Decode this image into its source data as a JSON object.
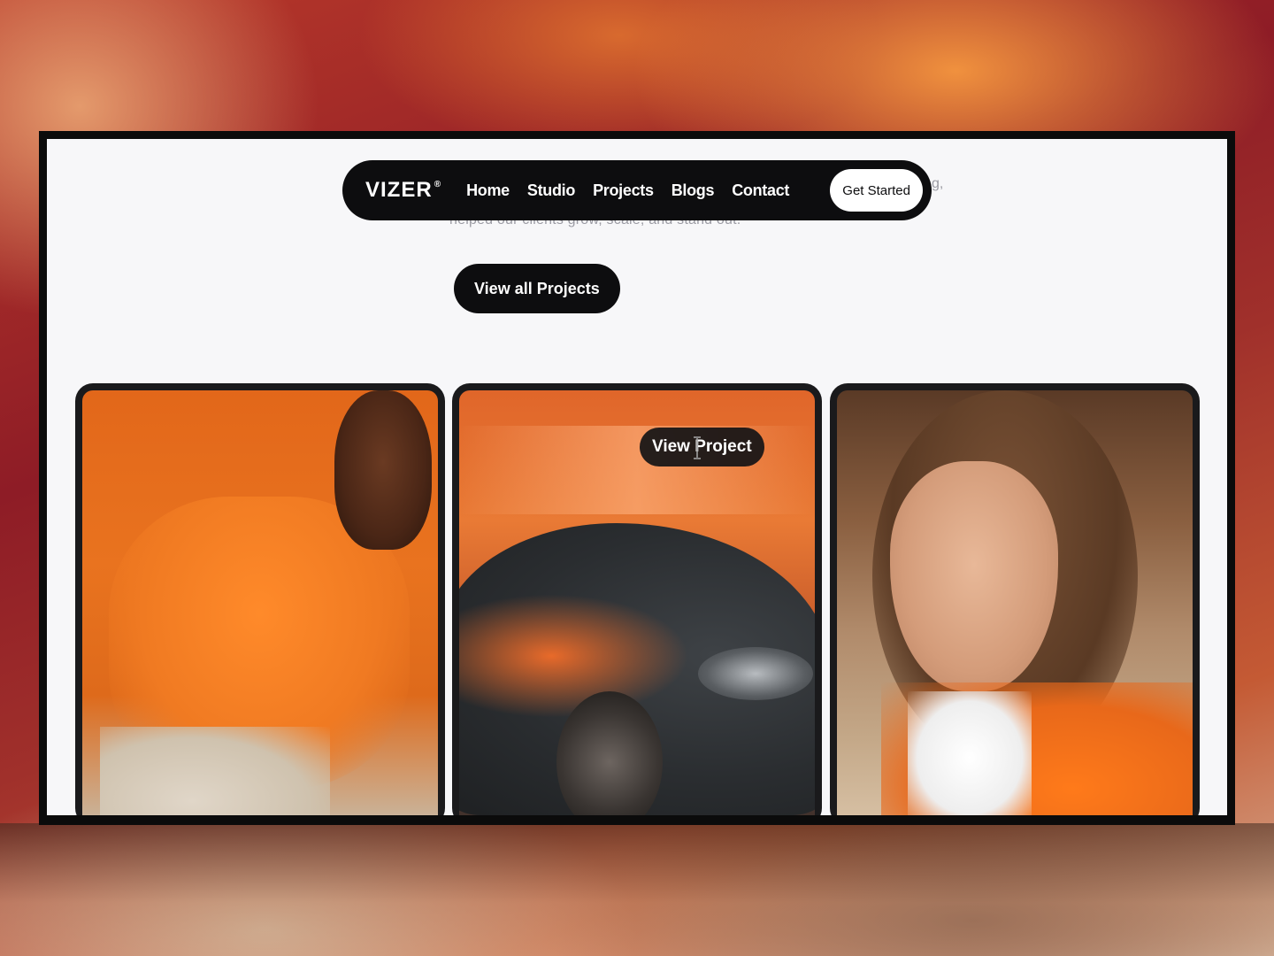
{
  "brand": {
    "name": "VIZER",
    "mark": "®"
  },
  "nav": {
    "links": [
      "Home",
      "Studio",
      "Projects",
      "Blogs",
      "Contact"
    ],
    "cta_label": "Get Started"
  },
  "hero": {
    "subtitle_fragment": "helped our clients grow, scale, and stand out.",
    "subtitle_tail": "g,"
  },
  "projects": {
    "view_all_label": "View all Projects",
    "hover_label": "View Project",
    "cards": [
      {
        "subject": "runner-in-orange-shirt"
      },
      {
        "subject": "dark-car-motion-blur"
      },
      {
        "subject": "woman-in-orange-jacket"
      }
    ]
  },
  "colors": {
    "accent": "#e9731f",
    "dark": "#0d0d0f",
    "page_bg": "#f7f7f9"
  }
}
